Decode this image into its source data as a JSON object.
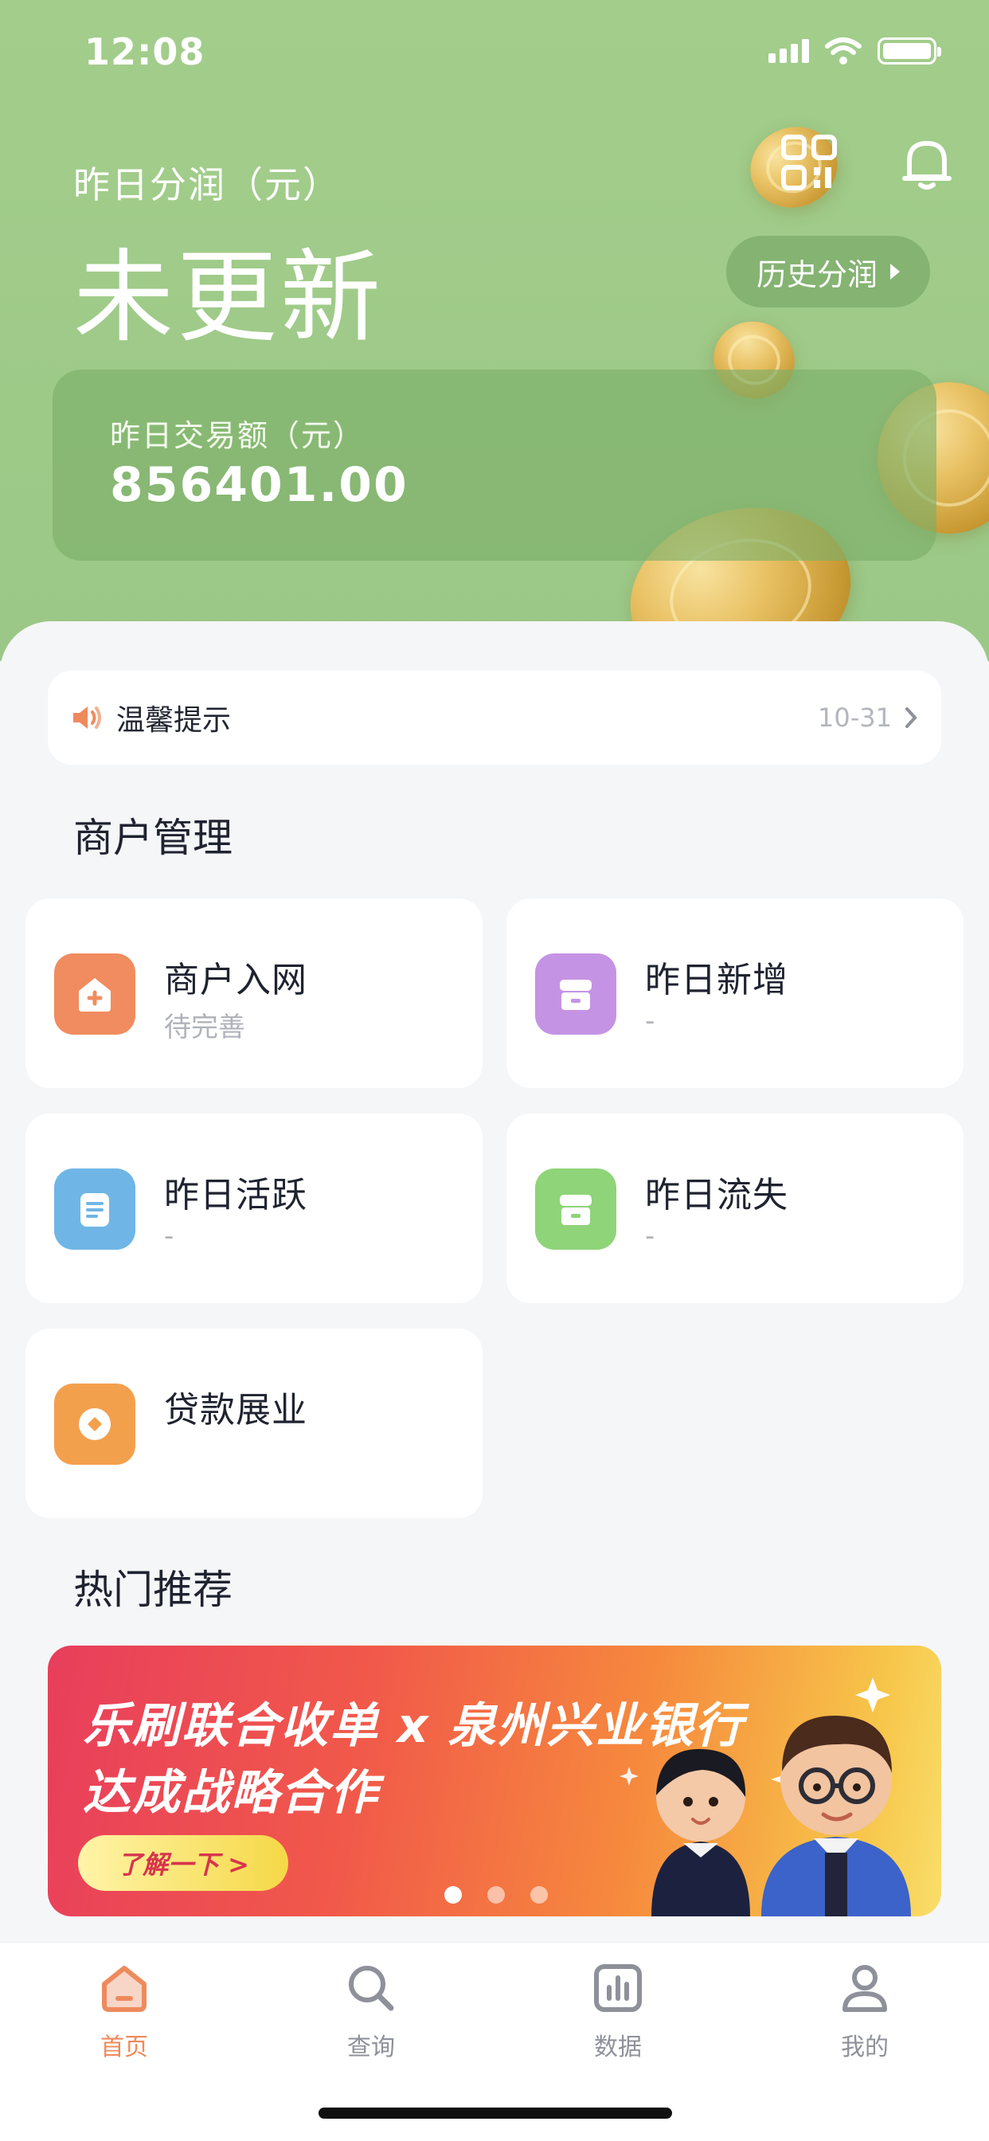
{
  "status_bar": {
    "time": "12:08"
  },
  "header": {
    "profit_label": "昨日分润（元）",
    "profit_value": "未更新",
    "history_button": "历史分润",
    "transaction": {
      "label": "昨日交易额（元）",
      "value": "856401.00"
    }
  },
  "notice": {
    "text": "温馨提示",
    "date": "10-31"
  },
  "merchant_section": {
    "title": "商户管理",
    "tiles": [
      {
        "title": "商户入网",
        "subtitle": "待完善",
        "icon": "store-add-icon",
        "color": "#f08c5f"
      },
      {
        "title": "昨日新增",
        "subtitle": "-",
        "icon": "shop-new-icon",
        "color": "#c593e4"
      },
      {
        "title": "昨日活跃",
        "subtitle": "-",
        "icon": "document-icon",
        "color": "#6fb6e6"
      },
      {
        "title": "昨日流失",
        "subtitle": "-",
        "icon": "shop-lost-icon",
        "color": "#8fd479"
      },
      {
        "title": "贷款展业",
        "subtitle": "",
        "icon": "loan-icon",
        "color": "#f3a04d"
      }
    ]
  },
  "hot_section": {
    "title": "热门推荐",
    "banner": {
      "line1": "乐刷联合收单 x 泉州兴业银行",
      "line2": "达成战略合作",
      "button": "了解一下 >",
      "active_slide": 1,
      "slide_count": 3
    }
  },
  "tabbar": {
    "tabs": [
      {
        "label": "首页",
        "icon": "home-icon",
        "active": true
      },
      {
        "label": "查询",
        "icon": "search-icon",
        "active": false
      },
      {
        "label": "数据",
        "icon": "chart-icon",
        "active": false
      },
      {
        "label": "我的",
        "icon": "user-icon",
        "active": false
      }
    ]
  },
  "colors": {
    "header_green": "#a3cd8b",
    "accent_orange": "#ee8a5d",
    "tab_inactive": "#8e9199"
  }
}
